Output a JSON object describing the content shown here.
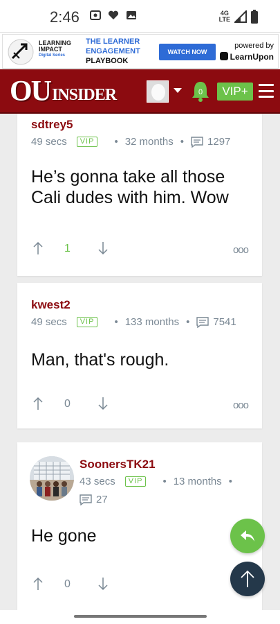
{
  "status_bar": {
    "time": "2:46",
    "network": "4G",
    "network_sub": "LTE"
  },
  "ad": {
    "brand_line1": "LEARNING",
    "brand_line2": "IMPACT",
    "brand_line3": "Digital Series",
    "headline_line1": "THE LEARNER",
    "headline_line2": "ENGAGEMENT",
    "headline_line3": "PLAYBOOK",
    "cta_label": "WATCH NOW",
    "powered_by": "powered by",
    "sponsor": "LearnUpon"
  },
  "header": {
    "logo_ou": "OU",
    "logo_insider": "INSIDER",
    "notification_count": "0",
    "vip_label": "VIP+"
  },
  "posts": [
    {
      "username": "sdtrey5",
      "time": "49 secs",
      "badge": "VIP",
      "membership": "32 months",
      "comment_count": "1297",
      "body": "He’s gonna take all those Cali dudes with him. Wow",
      "votes": "1"
    },
    {
      "username": "kwest2",
      "time": "49 secs",
      "badge": "VIP",
      "membership": "133 months",
      "comment_count": "7541",
      "body": "Man, that's rough.",
      "votes": "0"
    },
    {
      "username": "SoonersTK21",
      "time": "43 secs",
      "badge": "VIP",
      "membership": "13 months",
      "comment_count": "27",
      "body": "He gone",
      "votes": "0"
    }
  ],
  "more_label": "ooo",
  "colors": {
    "header_bg": "#8c0b10",
    "accent_green": "#6cc24a",
    "username": "#8c0b10",
    "meta": "#7a8894",
    "scroll_top_bg": "#24384a"
  }
}
